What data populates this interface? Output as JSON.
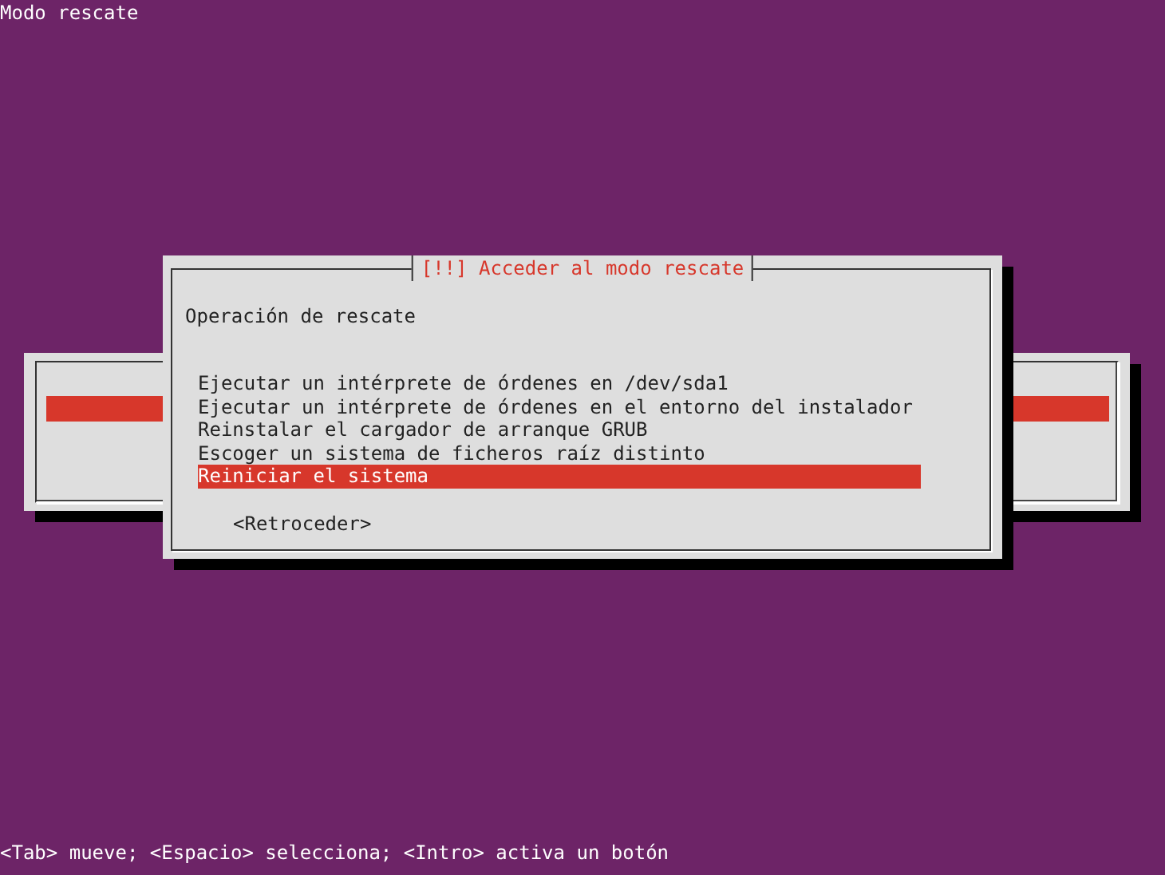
{
  "screen_title": "Modo rescate",
  "back_dialog": {
    "kind": "progress"
  },
  "dialog": {
    "title": "[!!] Acceder al modo rescate",
    "prompt": "Operación de rescate",
    "options": [
      {
        "label": "Ejecutar un intérprete de órdenes en /dev/sda1",
        "selected": false
      },
      {
        "label": "Ejecutar un intérprete de órdenes en el entorno del instalador",
        "selected": false
      },
      {
        "label": "Reinstalar el cargador de arranque GRUB",
        "selected": false
      },
      {
        "label": "Escoger un sistema de ficheros raíz distinto",
        "selected": false
      },
      {
        "label": "Reiniciar el sistema",
        "selected": true
      }
    ],
    "buttons": [
      "<Retroceder>"
    ]
  },
  "status_bar": "<Tab> mueve; <Espacio> selecciona; <Intro> activa un botón"
}
